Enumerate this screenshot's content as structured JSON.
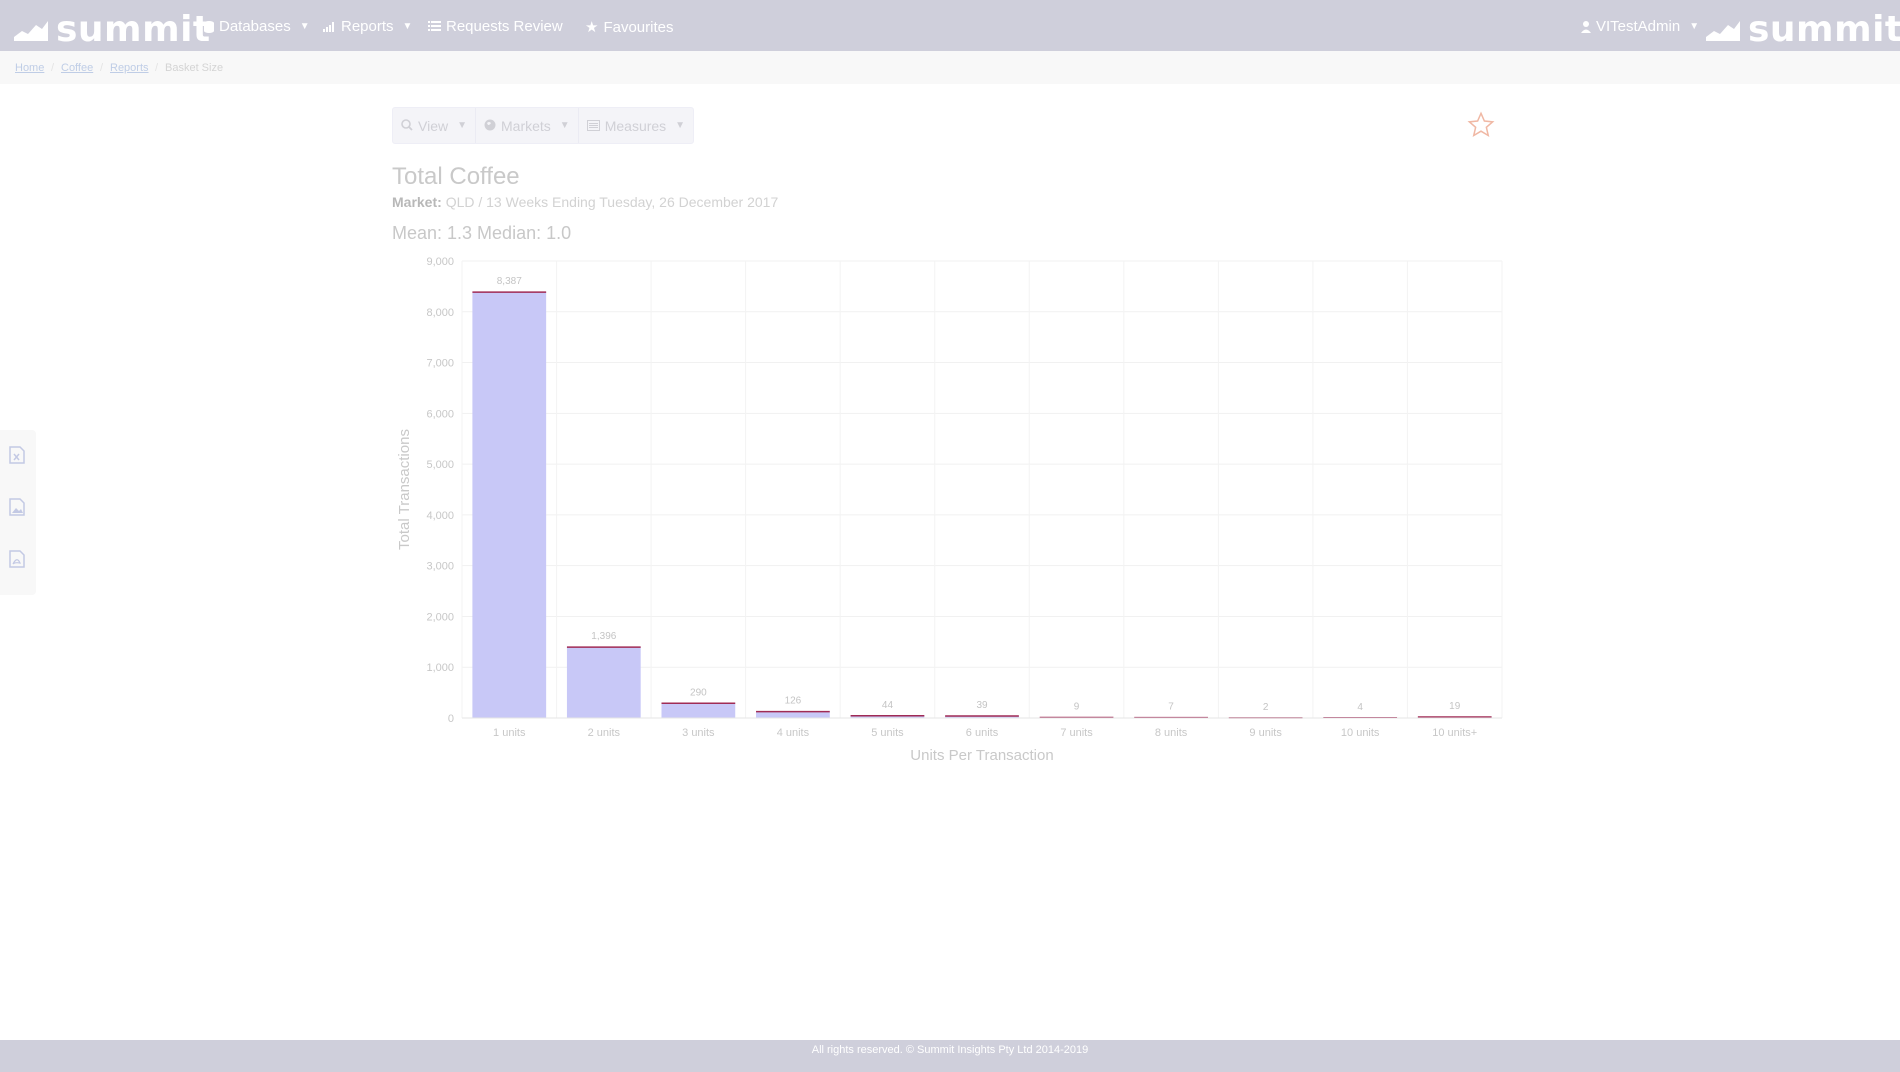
{
  "navbar": {
    "brand": "summit",
    "menus": [
      {
        "label": "Databases",
        "icon": "database-icon",
        "dropdown": true
      },
      {
        "label": "Reports",
        "icon": "bar-chart-icon",
        "dropdown": true
      },
      {
        "label": "Requests Review",
        "icon": "list-icon",
        "dropdown": false
      },
      {
        "label": "Favourites",
        "icon": "star-icon",
        "dropdown": false
      }
    ],
    "user": "VITestAdmin",
    "brand_right": "summit"
  },
  "breadcrumb": [
    "Home",
    "Coffee",
    "Reports",
    "Basket Size"
  ],
  "toolbar": {
    "view_label": "View",
    "markets_label": "Markets",
    "measures_label": "Measures"
  },
  "report": {
    "title": "Total Coffee",
    "market_label": "Market:",
    "market_value": "QLD / 13 Weeks Ending Tuesday, 26 December 2017",
    "stats": "Mean: 1.3 Median: 1.0"
  },
  "chart_data": {
    "type": "bar",
    "categories": [
      "1 units",
      "2 units",
      "3 units",
      "4 units",
      "5 units",
      "6 units",
      "7 units",
      "8 units",
      "9 units",
      "10 units",
      "10 units+"
    ],
    "values": [
      8387,
      1396,
      290,
      126,
      44,
      39,
      9,
      7,
      2,
      4,
      19
    ],
    "data_labels": [
      "8,387",
      "1,396",
      "290",
      "126",
      "44",
      "39",
      "9",
      "7",
      "2",
      "4",
      "19"
    ],
    "xlabel": "Units Per Transaction",
    "ylabel": "Total Transactions",
    "ylim": [
      0,
      9000
    ],
    "yticks": [
      "0",
      "1,000",
      "2,000",
      "3,000",
      "4,000",
      "5,000",
      "6,000",
      "7,000",
      "8,000",
      "9,000"
    ],
    "grid": true,
    "bar_color": "#c8c8f7",
    "bar_top_color": "#a02b55"
  },
  "footer": {
    "text": "All rights reserved. © Summit Insights Pty Ltd 2014-2019"
  },
  "colors": {
    "navbar": "#cfcfdb",
    "star": "#f0b8a4"
  }
}
